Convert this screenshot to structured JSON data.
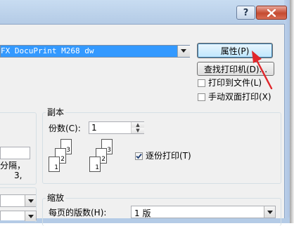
{
  "titlebar": {
    "help_label": "?",
    "close_label": "x"
  },
  "printer": {
    "selected": "FX DocuPrint M268 dw",
    "properties_button": "属性(P)",
    "find_printer_button": "查找打印机(D)...",
    "print_to_file": "打印到文件(L)",
    "manual_duplex": "手动双面打印(X)"
  },
  "left_group": {
    "text_line1": "分隔，",
    "text_line2": "3,"
  },
  "copies": {
    "legend": "副本",
    "count_label": "份数(C):",
    "count_value": "1",
    "collate_label": "逐份打印(T)",
    "collate_checked": true,
    "page_numbers": [
      "1",
      "2",
      "3"
    ]
  },
  "zoom": {
    "legend": "缩放",
    "pages_per_sheet_label": "每页的版数(H):",
    "pages_per_sheet_value": "1 版"
  },
  "colors": {
    "selection": "#3399ff",
    "annotation_arrow": "#e0262b"
  }
}
